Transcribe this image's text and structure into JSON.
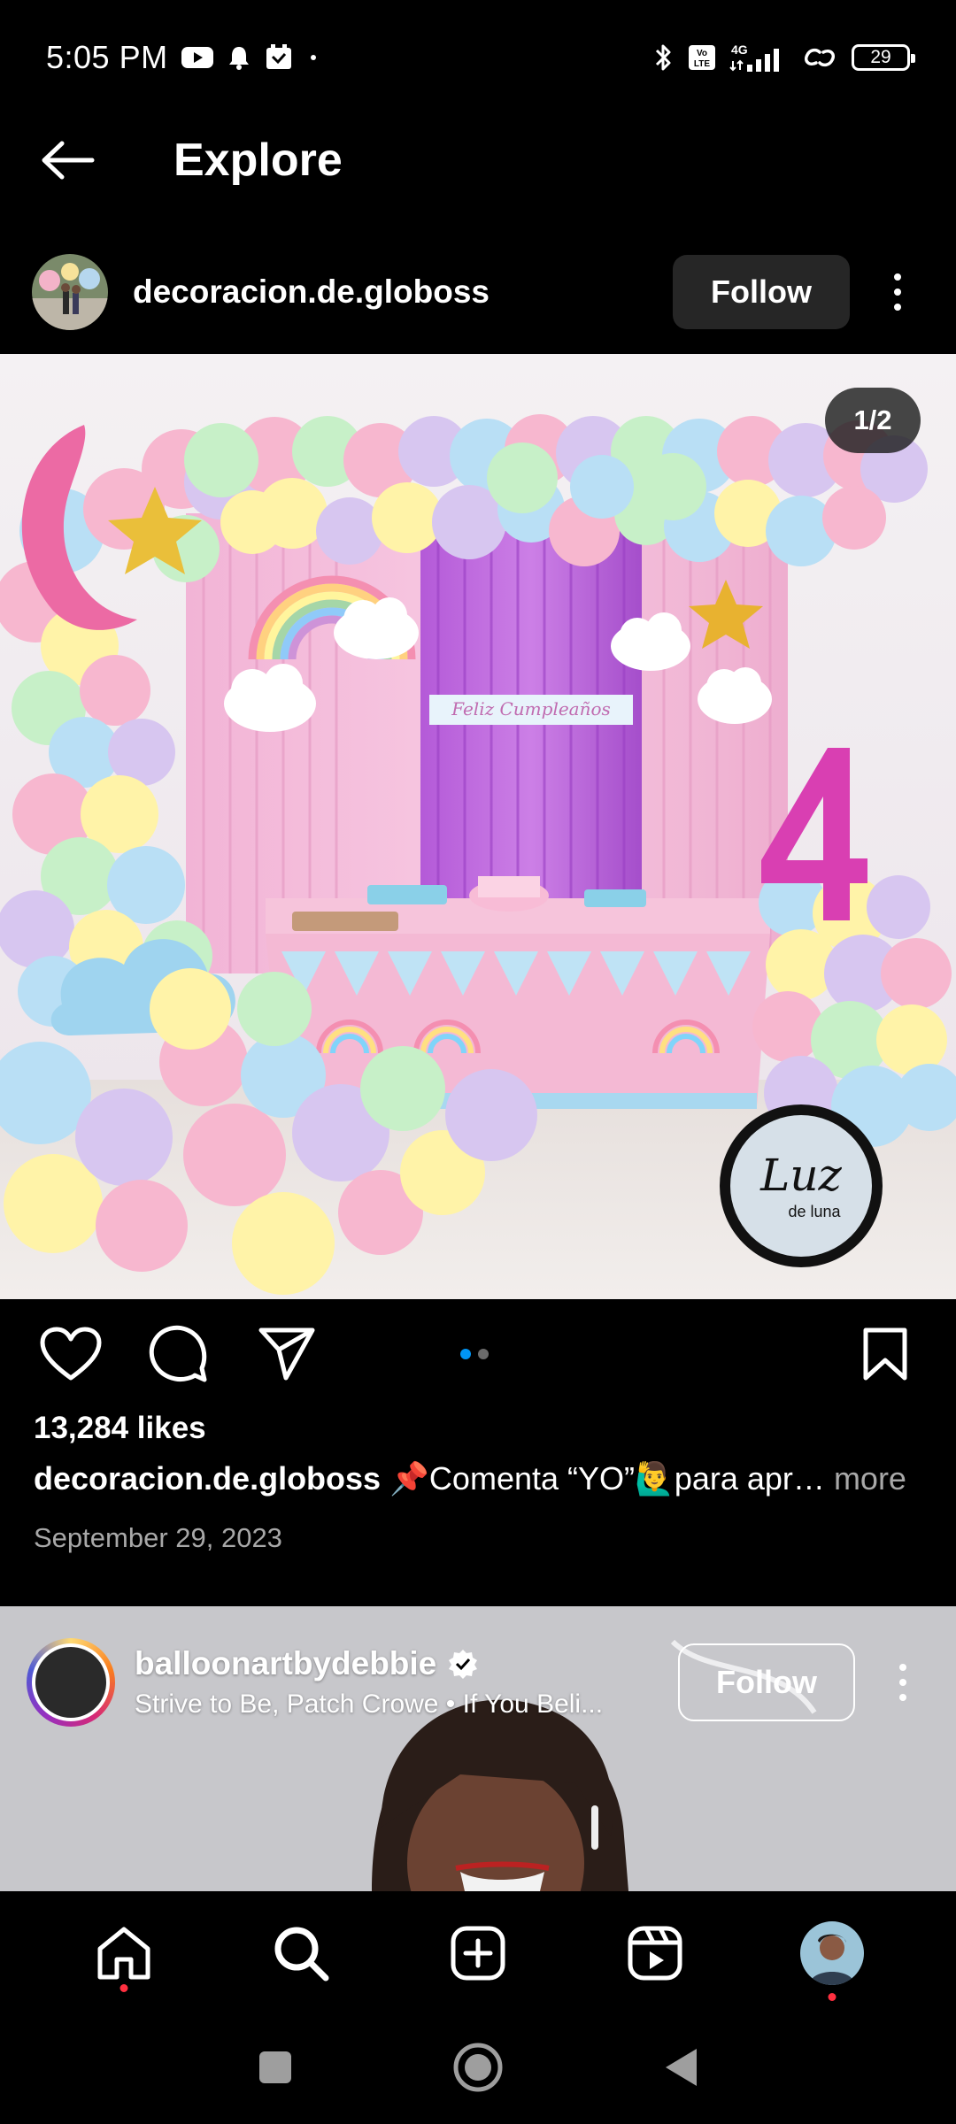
{
  "status_bar": {
    "time": "5:05 PM",
    "battery": "29",
    "network": "4G"
  },
  "header": {
    "title": "Explore"
  },
  "post": {
    "username": "decoracion.de.globoss",
    "follow_label": "Follow",
    "counter": "1/2",
    "photo_sign_text": "Feliz Cumpleaños",
    "watermark_text": "Luz de luna",
    "likes": "13,284 likes",
    "caption_user": "decoracion.de.globoss",
    "caption_text": "📌Comenta “YO”🙋‍♂️para apr…",
    "caption_more": "more",
    "date": "September 29, 2023",
    "carousel": {
      "total": 2,
      "active": 1
    }
  },
  "next_post": {
    "username": "balloonartbydebbie",
    "verified": true,
    "subtitle": "Strive to Be, Patch Crowe • If You Beli...",
    "follow_label": "Follow"
  },
  "bottom_nav": {
    "items": [
      "home-icon",
      "search-icon",
      "create-icon",
      "reels-icon",
      "profile-avatar"
    ]
  },
  "colors": {
    "background": "#000000",
    "follow_button": "#262626",
    "accent_blue": "#0095f6",
    "notification_red": "#ff3040",
    "muted_text": "#a8a8a8"
  }
}
